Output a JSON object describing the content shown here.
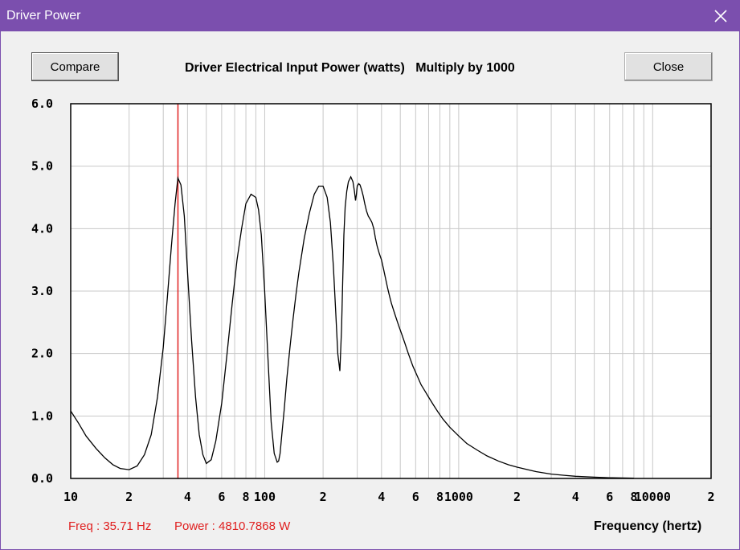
{
  "window": {
    "title": "Driver Power"
  },
  "toolbar": {
    "compare_label": "Compare",
    "close_label": "Close"
  },
  "status": {
    "freq": "Freq : 35.71 Hz",
    "power": "Power : 4810.7868 W"
  },
  "chart_data": {
    "type": "line",
    "title": "Driver Electrical Input Power (watts)   Multiply by 1000",
    "xlabel": "Frequency (hertz)",
    "ylabel": "",
    "xscale": "log",
    "xlim": [
      10,
      20000
    ],
    "ylim": [
      0,
      6
    ],
    "grid": true,
    "y_ticks": [
      "0.0",
      "1.0",
      "2.0",
      "3.0",
      "4.0",
      "5.0",
      "6.0"
    ],
    "x_ticks": [
      {
        "v": 10,
        "label": "10"
      },
      {
        "v": 20,
        "label": "2"
      },
      {
        "v": 40,
        "label": "4"
      },
      {
        "v": 60,
        "label": "6"
      },
      {
        "v": 80,
        "label": "8"
      },
      {
        "v": 100,
        "label": "100"
      },
      {
        "v": 200,
        "label": "2"
      },
      {
        "v": 400,
        "label": "4"
      },
      {
        "v": 600,
        "label": "6"
      },
      {
        "v": 800,
        "label": "8"
      },
      {
        "v": 1000,
        "label": "1000"
      },
      {
        "v": 2000,
        "label": "2"
      },
      {
        "v": 4000,
        "label": "4"
      },
      {
        "v": 6000,
        "label": "6"
      },
      {
        "v": 8000,
        "label": "8"
      },
      {
        "v": 10000,
        "label": "10000"
      },
      {
        "v": 20000,
        "label": "2"
      }
    ],
    "cursor_x": 35.71,
    "colors": {
      "line": "#000000",
      "cursor": "#e02020",
      "grid": "#c8c8c8",
      "plot_bg": "#ffffff"
    },
    "series": [
      {
        "x": [
          10,
          11,
          12,
          13.5,
          15,
          16.5,
          18,
          20,
          22,
          24,
          26,
          28,
          30,
          31.5,
          33,
          34.5,
          35.7,
          37,
          38.5,
          40,
          42,
          44,
          46,
          48,
          50,
          53,
          56,
          60,
          64,
          68,
          72,
          76,
          80,
          85,
          90,
          93,
          96,
          100,
          104,
          108,
          112,
          116,
          118,
          120,
          123,
          126,
          130,
          135,
          140,
          145,
          150,
          160,
          170,
          180,
          190,
          200,
          210,
          218,
          226,
          232,
          238,
          244,
          249,
          253,
          256,
          260,
          265,
          270,
          278,
          285,
          290,
          294,
          297,
          300,
          305,
          310,
          316,
          322,
          328,
          335,
          342,
          350,
          357,
          365,
          372,
          380,
          390,
          400,
          410,
          420,
          430,
          440,
          450,
          470,
          490,
          510,
          530,
          550,
          580,
          610,
          640,
          670,
          700,
          740,
          780,
          830,
          900,
          1000,
          1100,
          1250,
          1400,
          1600,
          1800,
          2000,
          2500,
          3000,
          3500,
          4000,
          5000,
          6000,
          7000,
          8000
        ],
        "y": [
          1.08,
          0.88,
          0.68,
          0.48,
          0.33,
          0.22,
          0.16,
          0.14,
          0.2,
          0.38,
          0.7,
          1.3,
          2.1,
          2.9,
          3.7,
          4.4,
          4.81,
          4.7,
          4.2,
          3.3,
          2.2,
          1.3,
          0.7,
          0.38,
          0.24,
          0.3,
          0.6,
          1.2,
          2.0,
          2.8,
          3.5,
          4.0,
          4.4,
          4.55,
          4.5,
          4.3,
          3.9,
          3.0,
          1.9,
          0.9,
          0.4,
          0.26,
          0.28,
          0.4,
          0.75,
          1.1,
          1.6,
          2.1,
          2.55,
          2.95,
          3.3,
          3.85,
          4.25,
          4.55,
          4.68,
          4.68,
          4.5,
          4.1,
          3.4,
          2.7,
          2.0,
          1.72,
          2.4,
          3.3,
          3.9,
          4.35,
          4.6,
          4.75,
          4.83,
          4.75,
          4.6,
          4.45,
          4.55,
          4.68,
          4.72,
          4.7,
          4.62,
          4.52,
          4.4,
          4.28,
          4.2,
          4.15,
          4.1,
          4.0,
          3.85,
          3.72,
          3.6,
          3.5,
          3.35,
          3.2,
          3.05,
          2.92,
          2.8,
          2.62,
          2.45,
          2.3,
          2.15,
          2.0,
          1.8,
          1.65,
          1.5,
          1.4,
          1.3,
          1.18,
          1.07,
          0.95,
          0.82,
          0.68,
          0.56,
          0.45,
          0.36,
          0.28,
          0.22,
          0.18,
          0.11,
          0.07,
          0.05,
          0.035,
          0.02,
          0.012,
          0.008,
          0.005
        ]
      }
    ]
  }
}
